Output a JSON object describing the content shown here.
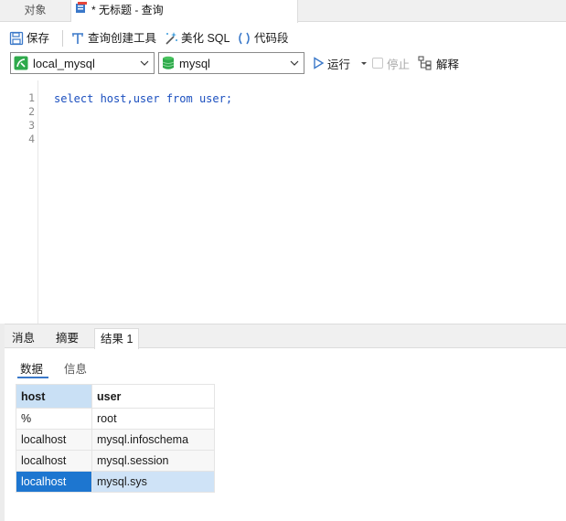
{
  "tabs": {
    "objects": "对象",
    "query": "* 无标题 - 查询"
  },
  "toolbar": {
    "save": "保存",
    "query_builder": "查询创建工具",
    "beautify": "美化 SQL",
    "snippet": "代码段"
  },
  "connection": {
    "conn_value": "local_mysql",
    "db_value": "mysql",
    "run": "运行",
    "stop": "停止",
    "explain": "解释"
  },
  "editor": {
    "line_numbers": [
      "1",
      "2",
      "3",
      "4"
    ],
    "code_line2": "select host,user from user;"
  },
  "result_tabs": [
    "消息",
    "摘要",
    "结果 1"
  ],
  "sub_tabs": [
    "数据",
    "信息"
  ],
  "grid": {
    "columns": [
      "host",
      "user"
    ],
    "rows": [
      [
        "%",
        "root"
      ],
      [
        "localhost",
        "mysql.infoschema"
      ],
      [
        "localhost",
        "mysql.session"
      ],
      [
        "localhost",
        "mysql.sys"
      ]
    ]
  },
  "colors": {
    "accent": "#1d76d0",
    "db_icon_green": "#2faa4c",
    "keyword_blue": "#1b4fbf"
  }
}
